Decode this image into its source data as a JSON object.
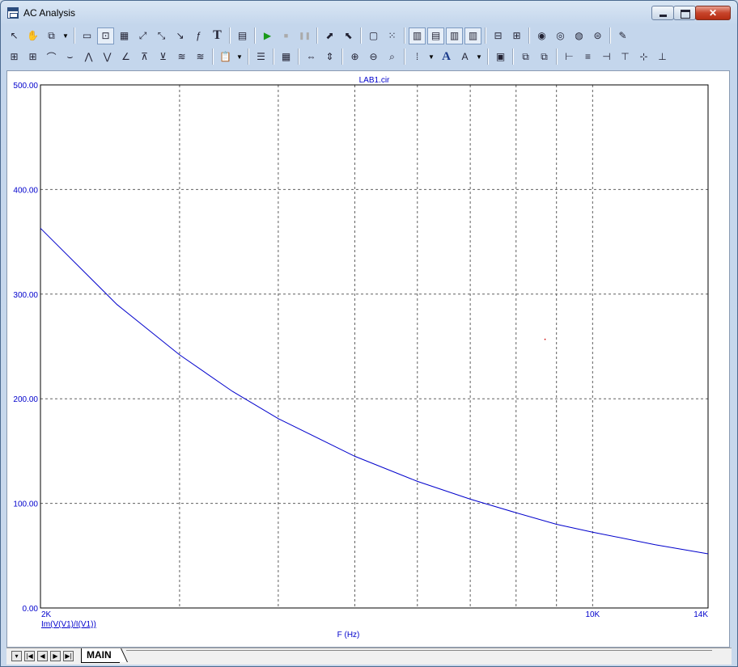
{
  "window": {
    "title": "AC Analysis"
  },
  "toolbar1": [
    {
      "name": "select-arrow-icon",
      "glyph": "↖"
    },
    {
      "name": "pan-hand-icon",
      "glyph": "✋"
    },
    {
      "name": "copy-icon",
      "glyph": "⧉"
    },
    {
      "name": "dropdown-arrow",
      "glyph": "▼",
      "drop": true
    },
    {
      "sep": true
    },
    {
      "name": "graphics-icon",
      "glyph": "▭"
    },
    {
      "name": "zoom-box-icon",
      "glyph": "⊡",
      "pressed": true
    },
    {
      "name": "scale-icon",
      "glyph": "▦"
    },
    {
      "name": "peak-icon",
      "glyph": "⤢"
    },
    {
      "name": "slope-icon",
      "glyph": "⤡"
    },
    {
      "name": "valley-icon",
      "glyph": "↘"
    },
    {
      "name": "function-icon",
      "glyph": "ƒ"
    },
    {
      "name": "text-tool-icon",
      "glyph": "T"
    },
    {
      "sep": true
    },
    {
      "name": "properties-icon",
      "glyph": "▤"
    },
    {
      "sep": true
    },
    {
      "name": "run-icon",
      "glyph": "▶"
    },
    {
      "name": "stop-icon",
      "glyph": "■"
    },
    {
      "name": "pause-icon",
      "glyph": "❚❚"
    },
    {
      "sep": true
    },
    {
      "name": "cursor-mode-icon",
      "glyph": "⬈"
    },
    {
      "name": "cursor-mode2-icon",
      "glyph": "⬉"
    },
    {
      "sep": true
    },
    {
      "name": "tag-box-icon",
      "glyph": "▢"
    },
    {
      "name": "tag-points-icon",
      "glyph": "⁙"
    },
    {
      "sep": true
    },
    {
      "name": "grid-1-icon",
      "glyph": "▥",
      "pressed": true
    },
    {
      "name": "grid-2-icon",
      "glyph": "▤",
      "pressed": true
    },
    {
      "name": "grid-3-icon",
      "glyph": "▥",
      "pressed": true
    },
    {
      "name": "grid-4-icon",
      "glyph": "▥",
      "pressed": true
    },
    {
      "sep": true
    },
    {
      "name": "minus-box-icon",
      "glyph": "⊟"
    },
    {
      "name": "plus-box-icon",
      "glyph": "⊞"
    },
    {
      "sep": true
    },
    {
      "name": "zoom-fit-icon",
      "glyph": "◉"
    },
    {
      "name": "zoom-prev-icon",
      "glyph": "◎"
    },
    {
      "name": "zoom-next-icon",
      "glyph": "◍"
    },
    {
      "name": "zoom-all-icon",
      "glyph": "⊜"
    },
    {
      "sep": true
    },
    {
      "name": "edit-box-icon",
      "glyph": "✎"
    }
  ],
  "toolbar2": [
    {
      "name": "data-points-icon",
      "glyph": "⊞"
    },
    {
      "name": "tokens-icon",
      "glyph": "⊞"
    },
    {
      "name": "peak-tool-icon",
      "glyph": "⌒"
    },
    {
      "name": "valley-tool-icon",
      "glyph": "⌣"
    },
    {
      "name": "high-icon",
      "glyph": "⋀"
    },
    {
      "name": "low-icon",
      "glyph": "⋁"
    },
    {
      "name": "inflection-icon",
      "glyph": "∠"
    },
    {
      "name": "global-high-icon",
      "glyph": "⊼"
    },
    {
      "name": "global-low-icon",
      "glyph": "⊻"
    },
    {
      "name": "top-icon",
      "glyph": "≋"
    },
    {
      "name": "bottom-icon",
      "glyph": "≋"
    },
    {
      "sep": true
    },
    {
      "name": "clipboard-icon",
      "glyph": "📋"
    },
    {
      "name": "dropdown-arrow-2",
      "glyph": "▼",
      "drop": true
    },
    {
      "sep": true
    },
    {
      "name": "list-icon",
      "glyph": "☰"
    },
    {
      "sep": true
    },
    {
      "name": "numeric-icon",
      "glyph": "▦"
    },
    {
      "sep": true
    },
    {
      "name": "horiz-cursor-icon",
      "glyph": "⇔"
    },
    {
      "name": "vert-cursor-icon",
      "glyph": "⇕"
    },
    {
      "sep": true
    },
    {
      "name": "zoom-in-icon",
      "glyph": "⊕"
    },
    {
      "name": "zoom-out-icon",
      "glyph": "⊖"
    },
    {
      "name": "zoom-region-icon",
      "glyph": "⌕"
    },
    {
      "sep": true
    },
    {
      "name": "grid-dots-icon",
      "glyph": "⁞"
    },
    {
      "name": "dropdown-arrow-3",
      "glyph": "▼",
      "drop": true
    },
    {
      "name": "font-icon",
      "glyph": "A"
    },
    {
      "name": "font-color-icon",
      "glyph": "A"
    },
    {
      "name": "dropdown-arrow-4",
      "glyph": "▼",
      "drop": true
    },
    {
      "sep": true
    },
    {
      "name": "stack-icon",
      "glyph": "▣"
    },
    {
      "sep": true
    },
    {
      "name": "send-back-icon",
      "glyph": "⧉"
    },
    {
      "name": "bring-front-icon",
      "glyph": "⧉"
    },
    {
      "sep": true
    },
    {
      "name": "align-left-icon",
      "glyph": "⊢"
    },
    {
      "name": "align-center-icon",
      "glyph": "≡"
    },
    {
      "name": "align-right-icon",
      "glyph": "⊣"
    },
    {
      "name": "align-top-icon",
      "glyph": "⊤"
    },
    {
      "name": "align-middle-icon",
      "glyph": "⊹"
    },
    {
      "name": "align-bottom-icon",
      "glyph": "⊥"
    }
  ],
  "chart_data": {
    "type": "line",
    "title": "LAB1.cir",
    "xlabel": "F (Hz)",
    "ylabel": "",
    "x_scale": "log",
    "xlim": [
      2000,
      14000
    ],
    "ylim": [
      0,
      500
    ],
    "y_ticks": [
      "0.00",
      "100.00",
      "200.00",
      "300.00",
      "400.00",
      "500.00"
    ],
    "x_ticks": [
      {
        "value": 2000,
        "label": "2K"
      },
      {
        "value": 10000,
        "label": "10K"
      },
      {
        "value": 14000,
        "label": "14K"
      }
    ],
    "x_gridlines": [
      3000,
      4000,
      5000,
      6000,
      7000,
      8000,
      9000,
      10000
    ],
    "grid": true,
    "series": [
      {
        "name": "Im(V(V1)/I(V1))",
        "color": "#0000cc",
        "x": [
          2000,
          2500,
          3000,
          3500,
          4000,
          5000,
          6000,
          7000,
          8000,
          9000,
          10000,
          12000,
          14000
        ],
        "y": [
          363,
          290,
          242,
          207,
          181,
          145,
          121,
          104,
          91,
          80,
          72.5,
          60.5,
          51.8
        ]
      }
    ],
    "marker_point": {
      "x": 8700,
      "y": 257,
      "color": "#cc0000"
    }
  },
  "tabs": {
    "active": "MAIN"
  },
  "colors": {
    "axis_text": "#0000cc",
    "grid": "#606060"
  }
}
